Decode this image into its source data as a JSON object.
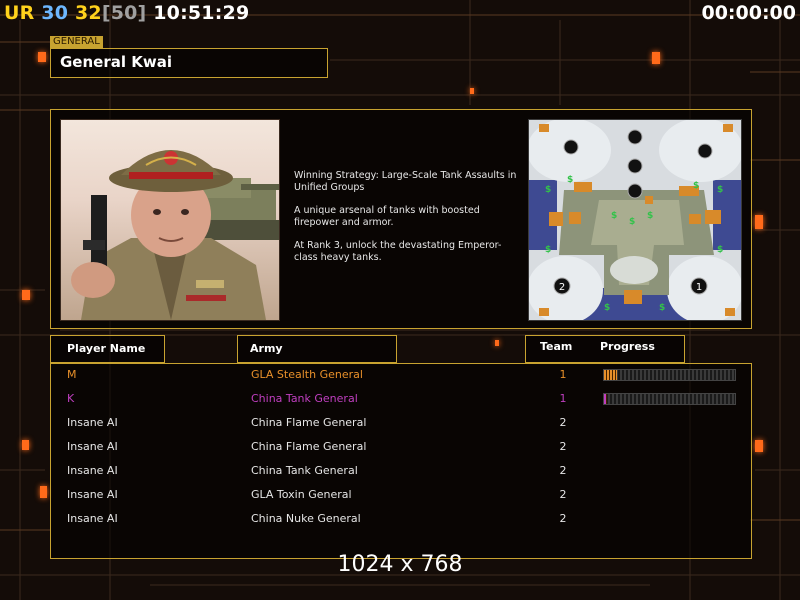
{
  "hud": {
    "ur_label": "UR",
    "fps_a": "30",
    "fps_b": "32",
    "fps_cap": "[50]",
    "clock": "10:51:29",
    "timer": "00:00:00",
    "colors": {
      "u": "#ffd21c",
      "r": "#69e03a",
      "a": "#6db7ff",
      "b": "#ffd21c",
      "cap": "#a0a0a0",
      "clock": "#ffffff"
    }
  },
  "general": {
    "tab": "GENERAL",
    "name": "General Kwai"
  },
  "description": [
    "Winning Strategy: Large-Scale Tank Assaults in Unified Groups",
    "A unique arsenal of tanks with boosted firepower and armor.",
    "At Rank 3, unlock the devastating Emperor-class heavy tanks."
  ],
  "headers": {
    "player": "Player Name",
    "army": "Army",
    "team": "Team",
    "progress": "Progress"
  },
  "players": [
    {
      "name": "M",
      "army": "GLA Stealth General",
      "team": "1",
      "color": "#e8902a",
      "progress": 0.1
    },
    {
      "name": "K",
      "army": "China Tank General",
      "team": "1",
      "color": "#c03fc0",
      "progress": 0.02
    },
    {
      "name": "Insane AI",
      "army": "China Flame General",
      "team": "2",
      "color": "#e6e6e6"
    },
    {
      "name": "Insane AI",
      "army": "China Flame General",
      "team": "2",
      "color": "#e6e6e6"
    },
    {
      "name": "Insane AI",
      "army": "China Tank General",
      "team": "2",
      "color": "#e6e6e6"
    },
    {
      "name": "Insane AI",
      "army": "GLA Toxin General",
      "team": "2",
      "color": "#e6e6e6"
    },
    {
      "name": "Insane AI",
      "army": "China Nuke General",
      "team": "2",
      "color": "#e6e6e6"
    }
  ],
  "map_labels": {
    "start_1": "1",
    "start_2": "2"
  },
  "resolution": "1024 x 768",
  "accent": "#c8a330"
}
